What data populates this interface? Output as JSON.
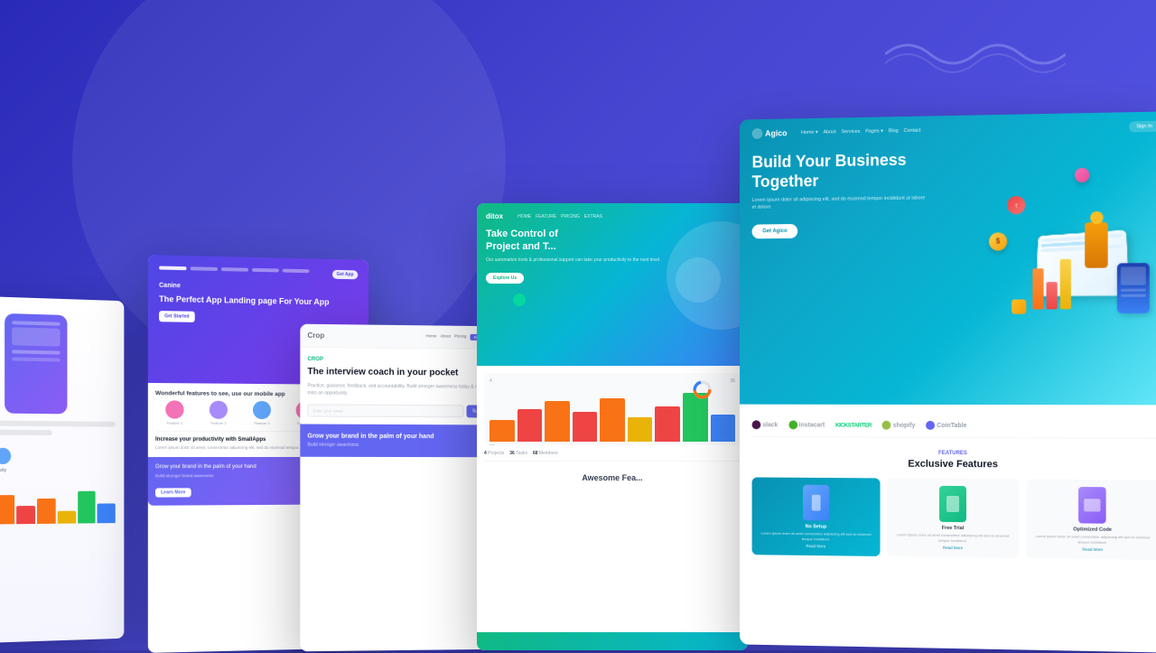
{
  "background": {
    "color": "#3d3dbf",
    "gradient_start": "#2a2ab8",
    "gradient_end": "#3838c8"
  },
  "card1": {
    "type": "app_landing_partial"
  },
  "card2": {
    "logo": "Canine",
    "title": "The Perfect App Landing page For Your App",
    "btn": "Get Started",
    "features_title": "Wonderful features to see, use our mobile app",
    "section_title": "Increase your productivity with SmallApps",
    "bottom_text": "Grow your brand in the palm of your hand"
  },
  "card3": {
    "brand": "Crop",
    "tag": "Crop",
    "title": "The interview coach in your pocket",
    "description": "Practice, guidance, feedback, and accountability. Build stronger awareness today & never miss an opportunity.",
    "input_placeholder": "Enter your email",
    "btn": "Submit",
    "purple_text": "Grow your brand in the palm of your hand",
    "purple_sub": "Build stronger awareness"
  },
  "card4": {
    "logo": "ditox",
    "nav_links": [
      "HOME",
      "FEATURE",
      "PRICING",
      "EXTRAS"
    ],
    "hero_text": "Take Control of Project and T...",
    "sub": "Our automation tools & professional support can take your productivity to the next level.",
    "cta": "Explore Us",
    "awesome_features": "Awesome Fea...",
    "data_rows": [
      {
        "num": "4",
        "label": "Projects"
      },
      {
        "num": "36",
        "label": "Tasks"
      },
      {
        "num": "68",
        "label": "Members"
      }
    ],
    "bars": [
      {
        "height": "40%",
        "color": "orange"
      },
      {
        "height": "60%",
        "color": "red"
      },
      {
        "height": "75%",
        "color": "orange"
      },
      {
        "height": "55%",
        "color": "red"
      },
      {
        "height": "80%",
        "color": "orange"
      },
      {
        "height": "45%",
        "color": "yellow"
      },
      {
        "height": "65%",
        "color": "red"
      },
      {
        "height": "90%",
        "color": "green"
      },
      {
        "height": "50%",
        "color": "blue"
      }
    ]
  },
  "card5": {
    "logo": "Agico",
    "nav_links": [
      "Home",
      "About",
      "Services",
      "Pages",
      "Blog",
      "Contact"
    ],
    "signin": "Sign In",
    "hero_title": "Build Your Business Together",
    "hero_sub": "Lorem ipsum dolor sit adipiscing elit, sed do eiusmod tempor incididunt ut labore et dolore.",
    "cta": "Get Agico",
    "brands": [
      "slack",
      "instacart",
      "KICKSTARTER",
      "shopify",
      "CoinTable"
    ],
    "features_tag": "FEATURES",
    "features_title": "Exclusive Features",
    "feature_cards": [
      {
        "title": "No Setup",
        "desc": "Lorem ipsum dolor sit amet consectetur adipiscing elit sed do eiusmod tempor incididunt.",
        "link": "Read More",
        "type": "blue"
      },
      {
        "title": "Free Trial",
        "desc": "Lorem ipsum dolor sit amet consectetur adipiscing elit sed do eiusmod tempor incididunt.",
        "link": "Read More",
        "type": "default"
      },
      {
        "title": "Optimized Code",
        "desc": "Lorem ipsum dolor sit amet consectetur adipiscing elit sed do eiusmod tempor incididunt.",
        "link": "Read More",
        "type": "default"
      }
    ]
  }
}
